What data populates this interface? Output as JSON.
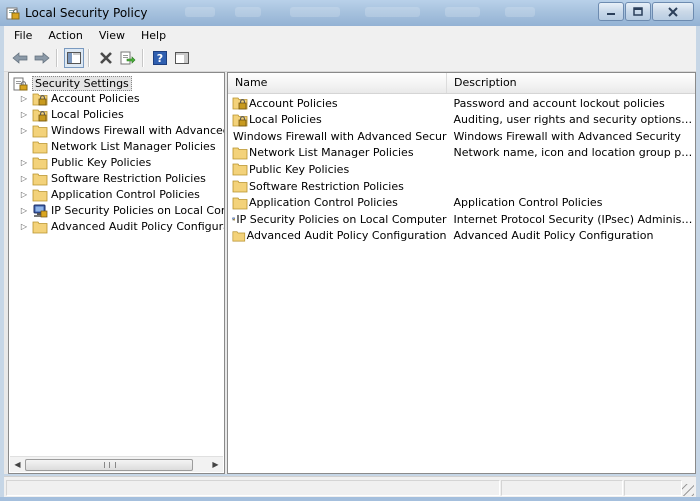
{
  "window": {
    "title": "Local Security Policy",
    "minimize_symbol": "—",
    "maximize_symbol": "▢",
    "close_symbol": "✕"
  },
  "menubar": {
    "items": [
      {
        "label": "File"
      },
      {
        "label": "Action"
      },
      {
        "label": "View"
      },
      {
        "label": "Help"
      }
    ]
  },
  "toolbar": {
    "buttons": [
      {
        "icon": "back-arrow-icon"
      },
      {
        "icon": "forward-arrow-icon"
      },
      {
        "icon": "show-hide-console-tree-icon",
        "pressed": true
      },
      {
        "icon": "delete-icon"
      },
      {
        "icon": "export-list-icon"
      },
      {
        "icon": "help-icon"
      },
      {
        "icon": "show-hide-action-pane-icon"
      }
    ]
  },
  "tree": {
    "root": {
      "label": "Security Settings",
      "icon": "security-settings-icon"
    },
    "items": [
      {
        "label": "Account Policies",
        "icon": "folder-lock-icon",
        "expandable": true
      },
      {
        "label": "Local Policies",
        "icon": "folder-lock-icon",
        "expandable": true
      },
      {
        "label": "Windows Firewall with Advanced Secu",
        "icon": "folder-icon",
        "expandable": true
      },
      {
        "label": "Network List Manager Policies",
        "icon": "folder-icon",
        "expandable": false
      },
      {
        "label": "Public Key Policies",
        "icon": "folder-icon",
        "expandable": true
      },
      {
        "label": "Software Restriction Policies",
        "icon": "folder-icon",
        "expandable": true
      },
      {
        "label": "Application Control Policies",
        "icon": "folder-icon",
        "expandable": true
      },
      {
        "label": "IP Security Policies on Local Compute",
        "icon": "ip-security-icon",
        "expandable": true
      },
      {
        "label": "Advanced Audit Policy Configuration",
        "icon": "folder-icon",
        "expandable": true
      }
    ],
    "scroll_left": "◀",
    "scroll_right": "▶"
  },
  "list": {
    "columns": [
      {
        "label": "Name"
      },
      {
        "label": "Description"
      }
    ],
    "rows": [
      {
        "name": "Account Policies",
        "description": "Password and account lockout policies",
        "icon": "folder-lock-icon"
      },
      {
        "name": "Local Policies",
        "description": "Auditing, user rights and security options polici...",
        "icon": "folder-lock-icon"
      },
      {
        "name": "Windows Firewall with Advanced Security",
        "description": "Windows Firewall with Advanced Security",
        "icon": "folder-icon"
      },
      {
        "name": "Network List Manager Policies",
        "description": "Network name, icon and location group policies.",
        "icon": "folder-icon"
      },
      {
        "name": "Public Key Policies",
        "description": "",
        "icon": "folder-icon"
      },
      {
        "name": "Software Restriction Policies",
        "description": "",
        "icon": "folder-icon"
      },
      {
        "name": "Application Control Policies",
        "description": "Application Control Policies",
        "icon": "folder-icon"
      },
      {
        "name": "IP Security Policies on Local Computer",
        "description": "Internet Protocol Security (IPsec) Administratio...",
        "icon": "ip-security-icon"
      },
      {
        "name": "Advanced Audit Policy Configuration",
        "description": "Advanced Audit Policy Configuration",
        "icon": "folder-icon"
      }
    ]
  },
  "colors": {
    "title_bar": "#a7c2de",
    "folder": "#f3d27a",
    "lock": "#c89a1e"
  }
}
